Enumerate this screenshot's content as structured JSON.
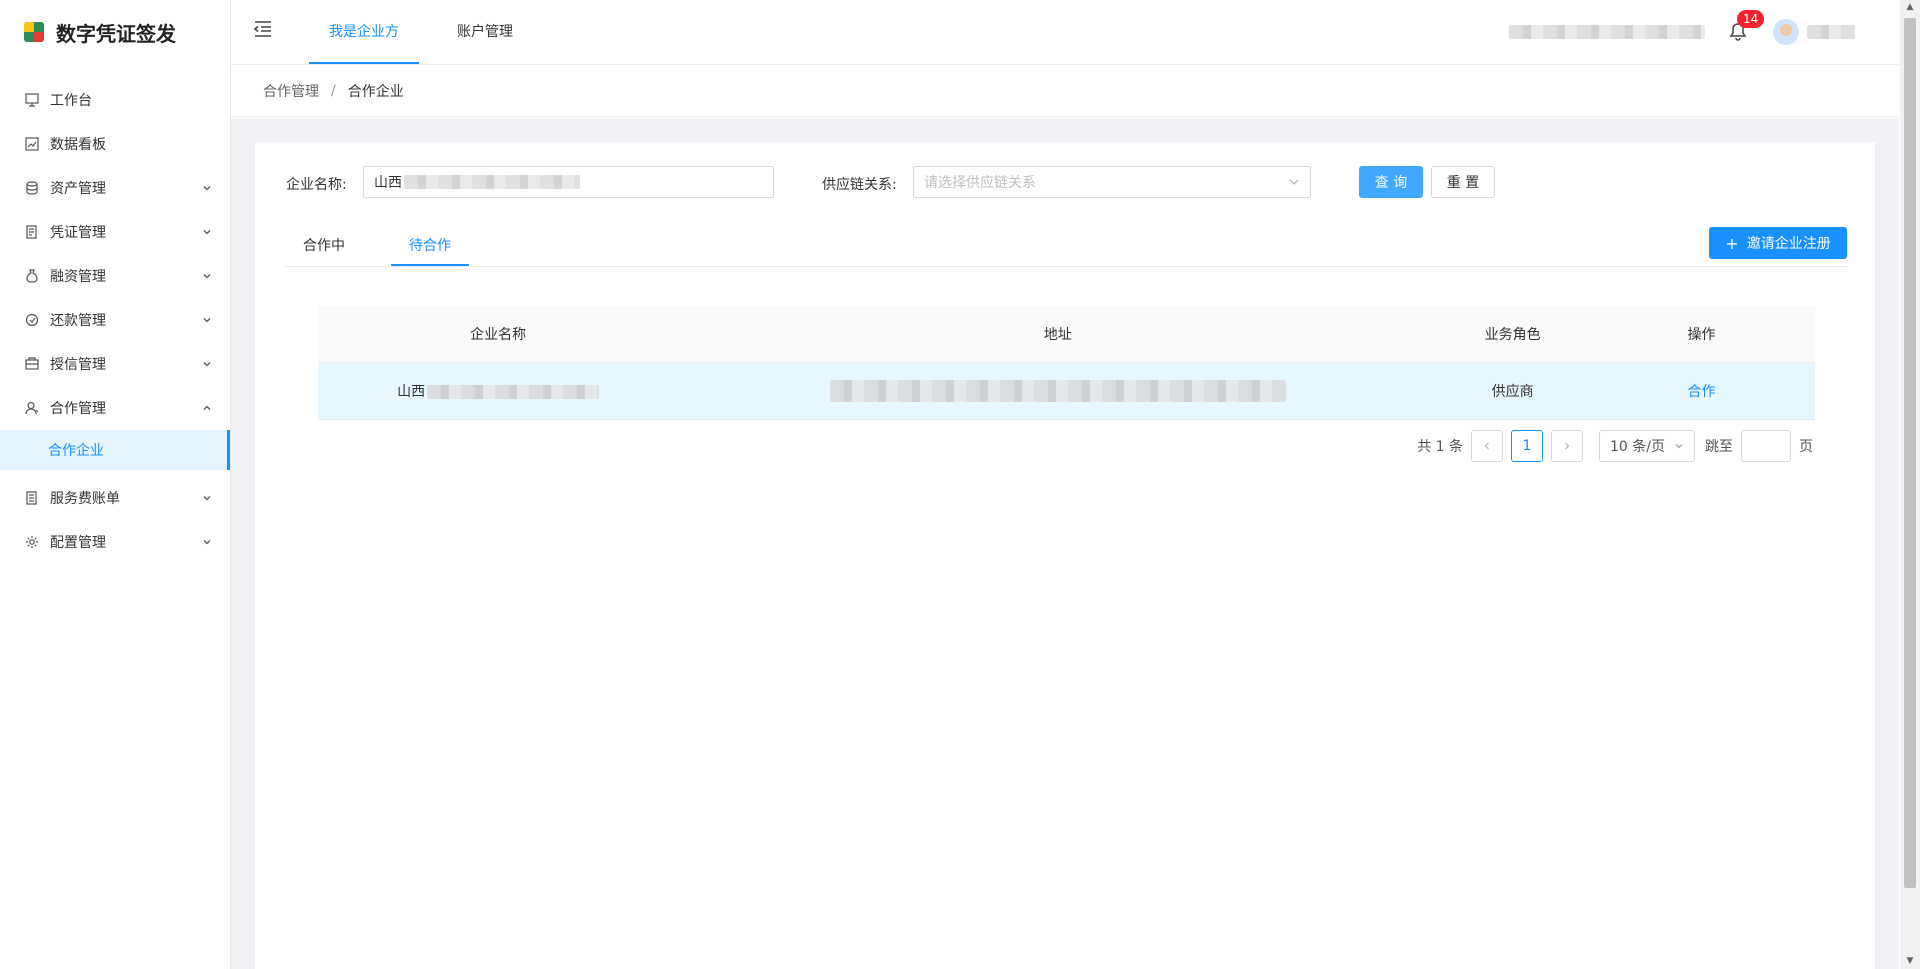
{
  "app": {
    "title": "数字凭证签发"
  },
  "header": {
    "tabs": [
      {
        "label": "我是企业方",
        "active": true
      },
      {
        "label": "账户管理",
        "active": false
      }
    ],
    "notification_count": "14"
  },
  "sidebar": {
    "items": [
      {
        "label": "工作台",
        "icon": "monitor-icon"
      },
      {
        "label": "数据看板",
        "icon": "chart-icon"
      },
      {
        "label": "资产管理",
        "icon": "database-icon"
      },
      {
        "label": "凭证管理",
        "icon": "document-icon"
      },
      {
        "label": "融资管理",
        "icon": "moneybag-icon"
      },
      {
        "label": "还款管理",
        "icon": "refund-icon"
      },
      {
        "label": "授信管理",
        "icon": "credit-icon"
      },
      {
        "label": "合作管理",
        "icon": "user-icon"
      },
      {
        "label": "服务费账单",
        "icon": "bill-icon"
      },
      {
        "label": "配置管理",
        "icon": "settings-icon"
      }
    ],
    "sub_active": "合作企业"
  },
  "breadcrumb": {
    "parent": "合作管理",
    "separator": "/",
    "current": "合作企业"
  },
  "filters": {
    "company_label": "企业名称:",
    "company_value": "山西",
    "supply_label": "供应链关系:",
    "supply_placeholder": "请选择供应链关系",
    "query_button": "查 询",
    "reset_button": "重 置"
  },
  "tabs": [
    {
      "label": "合作中",
      "active": false
    },
    {
      "label": "待合作",
      "active": true
    }
  ],
  "invite_button": "邀请企业注册",
  "table": {
    "columns": [
      "企业名称",
      "地址",
      "业务角色",
      "操作"
    ],
    "rows": [
      {
        "name": "山西",
        "role": "供应商",
        "action": "合作"
      }
    ]
  },
  "pagination": {
    "total": "共 1 条",
    "current_page": "1",
    "page_size": "10 条/页",
    "jump_label": "跳至",
    "page_suffix": "页"
  },
  "colors": {
    "accent": "#1890ff",
    "active_row": "#e6f7ff",
    "badge": "#f5222d"
  }
}
